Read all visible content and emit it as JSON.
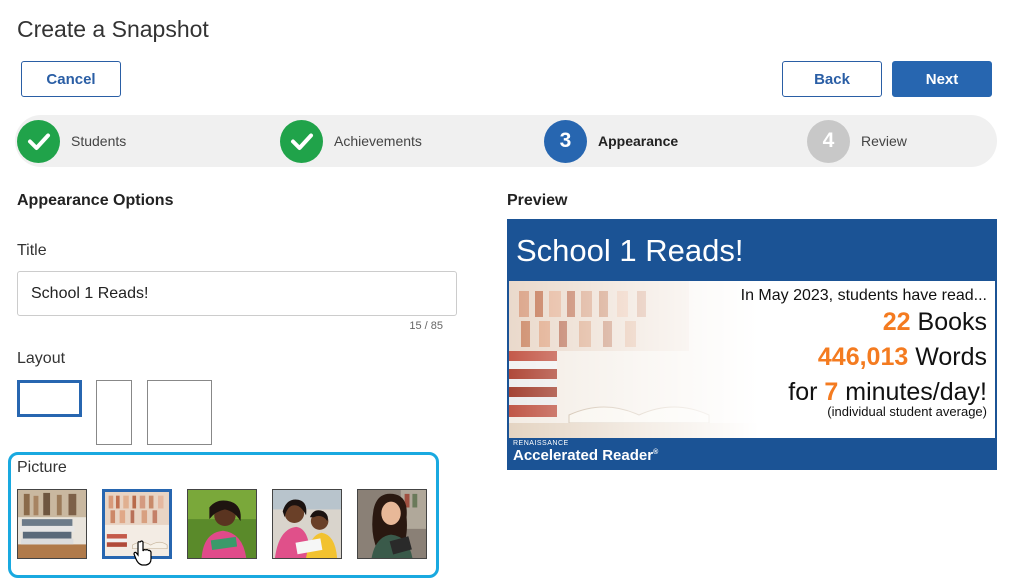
{
  "page": {
    "title": "Create a Snapshot"
  },
  "buttons": {
    "cancel": "Cancel",
    "back": "Back",
    "next": "Next"
  },
  "stepper": {
    "steps": [
      {
        "label": "Students",
        "state": "done",
        "number": ""
      },
      {
        "label": "Achievements",
        "state": "done",
        "number": ""
      },
      {
        "label": "Appearance",
        "state": "current",
        "number": "3"
      },
      {
        "label": "Review",
        "state": "todo",
        "number": "4"
      }
    ]
  },
  "appearance": {
    "heading": "Appearance Options",
    "title_label": "Title",
    "title_value": "School 1 Reads!",
    "char_count": "15 / 85",
    "layout_label": "Layout",
    "selected_layout": 1,
    "picture_label": "Picture",
    "selected_picture": 2,
    "pictures": [
      "books-stack-icon",
      "library-books-icon",
      "girl-reading-icon",
      "kids-reading-icon",
      "girl-tablet-icon"
    ]
  },
  "preview": {
    "heading": "Preview",
    "title": "School 1 Reads!",
    "intro": "In May 2023, students have read...",
    "books_value": "22",
    "books_label": "Books",
    "words_value": "446,013",
    "words_label": "Words",
    "minutes_prefix": "for",
    "minutes_value": "7",
    "minutes_label": "minutes/day!",
    "note": "(individual student average)",
    "brand_small": "RENAISSANCE",
    "brand_main": "Accelerated Reader",
    "brand_mark": "®"
  },
  "colors": {
    "primary": "#2766b0",
    "success": "#20a34a",
    "accent": "#f47b20",
    "highlight": "#19a9e0",
    "preview_bg": "#1b5395"
  }
}
